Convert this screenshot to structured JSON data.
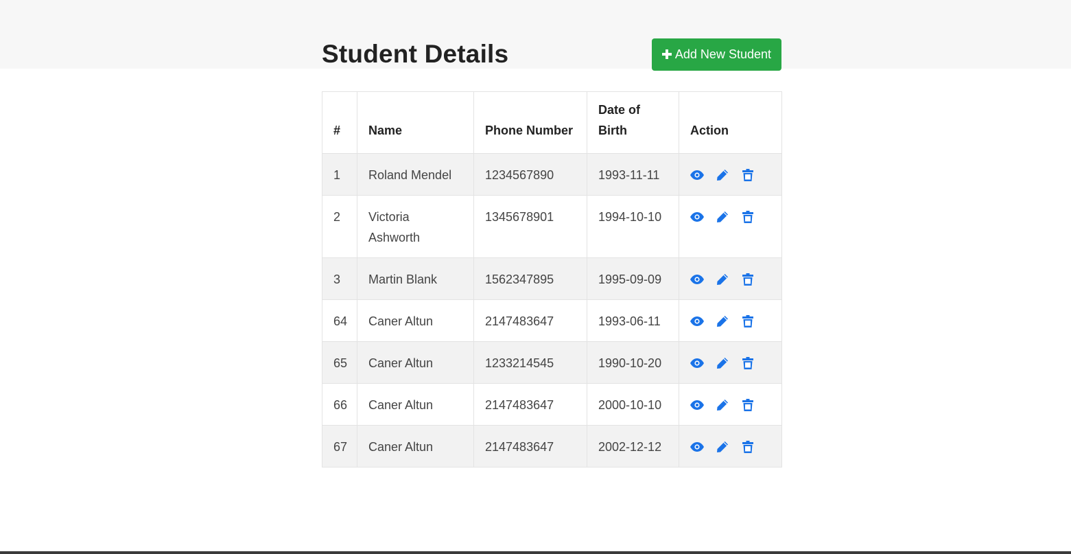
{
  "page": {
    "title": "Student Details",
    "add_button_label": "Add New Student"
  },
  "colors": {
    "accent_green": "#28a745",
    "icon_blue": "#1a73e8",
    "row_stripe": "#f2f2f2"
  },
  "table": {
    "headers": {
      "num": "#",
      "name": "Name",
      "phone": "Phone Number",
      "dob": "Date of Birth",
      "action": "Action"
    },
    "rows": [
      {
        "id": "1",
        "name": "Roland Mendel",
        "phone": "1234567890",
        "dob": "1993-11-11"
      },
      {
        "id": "2",
        "name": "Victoria Ashworth",
        "phone": "1345678901",
        "dob": "1994-10-10"
      },
      {
        "id": "3",
        "name": "Martin Blank",
        "phone": "1562347895",
        "dob": "1995-09-09"
      },
      {
        "id": "64",
        "name": "Caner Altun",
        "phone": "2147483647",
        "dob": "1993-06-11"
      },
      {
        "id": "65",
        "name": "Caner Altun",
        "phone": "1233214545",
        "dob": "1990-10-20"
      },
      {
        "id": "66",
        "name": "Caner Altun",
        "phone": "2147483647",
        "dob": "2000-10-10"
      },
      {
        "id": "67",
        "name": "Caner Altun",
        "phone": "2147483647",
        "dob": "2002-12-12"
      }
    ],
    "row_action_icons": [
      "eye-icon",
      "pencil-icon",
      "trash-icon"
    ]
  }
}
